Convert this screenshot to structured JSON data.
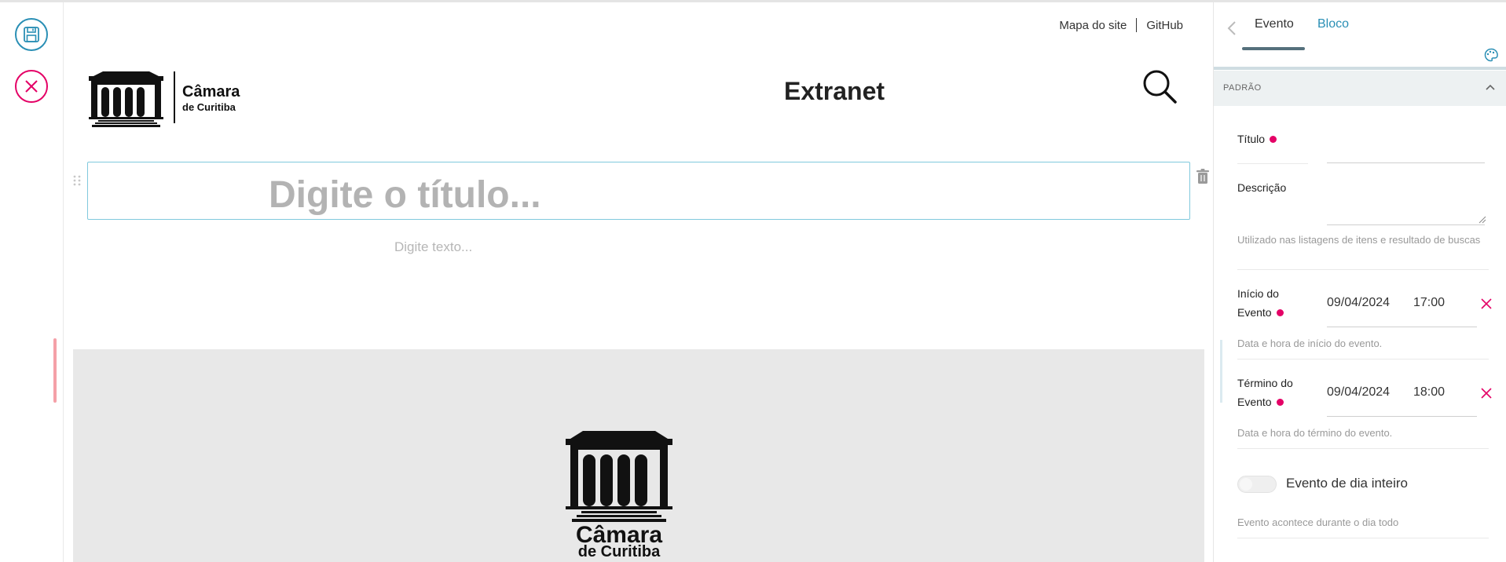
{
  "header": {
    "links": [
      {
        "label": "Mapa do site"
      },
      {
        "label": "GitHub"
      }
    ],
    "logo_text": {
      "line1": "Câmara",
      "line2": "de Curitiba"
    },
    "site_title": "Extranet"
  },
  "editor": {
    "title_placeholder": "Digite o título...",
    "text_placeholder": "Digite texto..."
  },
  "image_block": {
    "logo_text": {
      "line1": "Câmara",
      "line2": "de Curitiba"
    }
  },
  "sidebar": {
    "tabs": [
      {
        "label": "Evento"
      },
      {
        "label": "Bloco"
      }
    ],
    "section": {
      "label": "PADRÃO"
    },
    "fields": {
      "titulo": {
        "label": "Título"
      },
      "descricao": {
        "label": "Descrição",
        "help": "Utilizado nas listagens de itens e resultado de buscas"
      },
      "inicio": {
        "label_line1": "Início do",
        "label_line2": "Evento",
        "date": "09/04/2024",
        "time": "17:00",
        "help": "Data e hora de início do evento."
      },
      "termino": {
        "label_line1": "Término do",
        "label_line2": "Evento",
        "date": "09/04/2024",
        "time": "18:00",
        "help": "Data e hora do término do evento."
      },
      "dia_inteiro": {
        "label": "Evento de dia inteiro",
        "help": "Evento acontece durante o dia todo",
        "checked": false
      }
    }
  },
  "colors": {
    "accent_blue": "#2a8fb5",
    "required_pink": "#e40166",
    "block_border": "#80c9dd"
  },
  "icons": {
    "save": "save-icon",
    "cancel": "close-icon",
    "search": "search-icon",
    "trash": "trash-icon",
    "back": "chevron-left-icon",
    "palette": "palette-icon",
    "collapse": "chevron-up-icon",
    "clear": "clear-x-icon"
  }
}
